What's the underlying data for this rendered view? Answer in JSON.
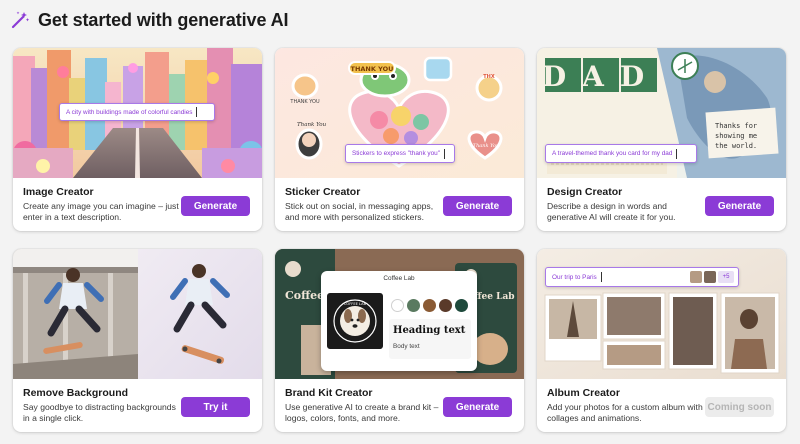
{
  "header": {
    "title": "Get started with generative AI",
    "icon": "magic-wand-icon"
  },
  "colors": {
    "accent": "#8b3bd6",
    "page_bg": "#f3f3f3",
    "disabled_bg": "#ececec",
    "disabled_text": "#b5b5b5"
  },
  "cards": [
    {
      "title": "Image Creator",
      "description": "Create any image you can imagine – just enter in a text description.",
      "button": "Generate",
      "prompt": "A city with buildings made of colorful candies"
    },
    {
      "title": "Sticker Creator",
      "description": "Stick out on social, in messaging apps, and more with personalized stickers.",
      "button": "Generate",
      "prompt": "Stickers to express \"thank you\"",
      "sticker_texts": [
        "THANK YOU",
        "THANK YOU",
        "Thank You",
        "Thank You",
        "THX"
      ]
    },
    {
      "title": "Design Creator",
      "description": "Describe a design in words and generative AI will create it for you.",
      "button": "Generate",
      "prompt": "A travel-themed thank you card for my dad",
      "card_big_text": "DAD",
      "card_note": "Thanks for showing me the world."
    },
    {
      "title": "Remove Background",
      "description": "Say goodbye to distracting backgrounds in a single click.",
      "button": "Try it"
    },
    {
      "title": "Brand Kit Creator",
      "description": "Use generative AI to create a brand kit – logos, colors, fonts, and more.",
      "button": "Generate",
      "kit": {
        "name": "Coffee Lab",
        "logo_text": "COFFEE LAB",
        "heading": "Heading text",
        "body": "Body text",
        "bg_text": "Coffee Lab",
        "swatches": [
          "#ffffff",
          "#5a7a60",
          "#8a5a34",
          "#5a3a2a",
          "#1e4a3c"
        ]
      }
    },
    {
      "title": "Album Creator",
      "description": "Add your photos for a custom album with collages and animations.",
      "button": "Coming soon",
      "prompt": "Our trip to Paris",
      "more_count": "+5"
    }
  ]
}
